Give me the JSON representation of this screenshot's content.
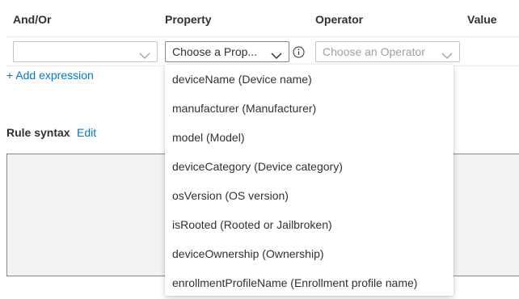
{
  "header": {
    "and_or": "And/Or",
    "property": "Property",
    "operator": "Operator",
    "value": "Value"
  },
  "row": {
    "and_or_value": "",
    "property_placeholder": "Choose a Prop...",
    "operator_placeholder": "Choose an Operator"
  },
  "add_expression": "+ Add expression",
  "rule_syntax": {
    "label": "Rule syntax",
    "edit": "Edit"
  },
  "property_menu": {
    "items": [
      "deviceName (Device name)",
      "manufacturer (Manufacturer)",
      "model (Model)",
      "deviceCategory (Device category)",
      "osVersion (OS version)",
      "isRooted (Rooted or Jailbroken)",
      "deviceOwnership (Ownership)",
      "enrollmentProfileName (Enrollment profile name)"
    ]
  },
  "colors": {
    "link": "#0078d4",
    "text": "#323130",
    "disabled_text": "#a19f9d",
    "syntax_bg": "#f3f2f1"
  }
}
